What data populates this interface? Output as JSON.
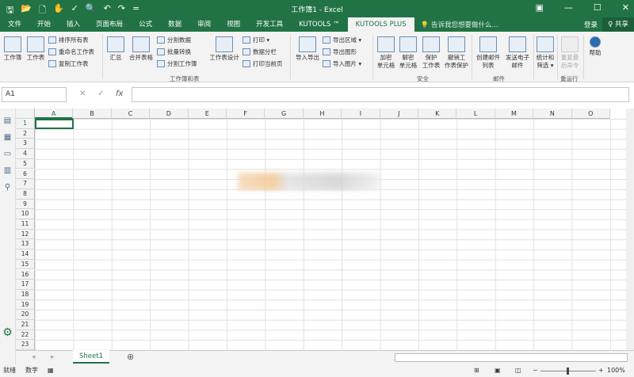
{
  "window": {
    "title": "工作簿1 - Excel",
    "controls": [
      "▣",
      "—",
      "☐",
      "✕"
    ]
  },
  "qat": [
    "🖫",
    "📂",
    "🗋",
    "✋",
    "✓",
    "🔍",
    "↶",
    "↷",
    "="
  ],
  "tabs": [
    "文件",
    "开始",
    "插入",
    "页面布局",
    "公式",
    "数据",
    "审阅",
    "视图",
    "开发工具",
    "KUTOOLS ™",
    "KUTOOLS PLUS"
  ],
  "active_tab": "KUTOOLS PLUS",
  "tell_me": "💡 告诉我您想要做什么...",
  "login": "登录",
  "share": "♀ 共享",
  "ribbon": {
    "workbook": "工作簿",
    "worksheet": "工作表",
    "sort_sheets": "排序所有表",
    "rename_sheets": "重命名工作表",
    "copy_sheets": "复制工作表",
    "summary": "汇总",
    "merge_tables": "合并表格",
    "split_data": "分割数据",
    "batch_convert": "批量转换",
    "split_workbook": "分割工作簿",
    "sheet_design": "工作表设计",
    "print": "打印 ▾",
    "data_split_col": "数据分栏",
    "print_current": "打印当前页",
    "group_workbook": "工作簿和表",
    "import_export": "导入导出",
    "export_range": "导出区域 ▾",
    "export_graphic": "导出图形",
    "import_picture": "导入图片 ▾",
    "encrypt_cells": [
      "加密",
      "单元格"
    ],
    "decrypt_cells": [
      "解密",
      "单元格"
    ],
    "protect_sheet": [
      "保护",
      "工作表"
    ],
    "unprotect_sheet": [
      "撤销工",
      "作表保护"
    ],
    "group_security": "安全",
    "create_mail_list": [
      "创建邮件",
      "列表"
    ],
    "send_email": [
      "发送电子",
      "邮件"
    ],
    "group_mail": "邮件",
    "stats_filter": [
      "统计和",
      "筛选 ▾"
    ],
    "rerun": [
      "重复最",
      "后命令"
    ],
    "group_rerun": "重运行",
    "help": "帮助"
  },
  "formula_bar": {
    "name_box": "A1",
    "cancel": "✕",
    "enter": "✓",
    "fx": "fx",
    "value": ""
  },
  "columns": [
    "A",
    "B",
    "C",
    "D",
    "E",
    "F",
    "G",
    "H",
    "I",
    "J",
    "K",
    "L",
    "M",
    "N",
    "O"
  ],
  "rows": [
    "1",
    "2",
    "3",
    "4",
    "5",
    "6",
    "7",
    "8",
    "9",
    "10",
    "11",
    "12",
    "13",
    "14",
    "15",
    "16",
    "17",
    "18",
    "19",
    "20",
    "21",
    "22",
    "23"
  ],
  "sheets": [
    "Sheet1"
  ],
  "status": {
    "ready": "就绪",
    "mode": "数字",
    "zoom": "100%"
  },
  "colors": {
    "accent": "#217346"
  }
}
